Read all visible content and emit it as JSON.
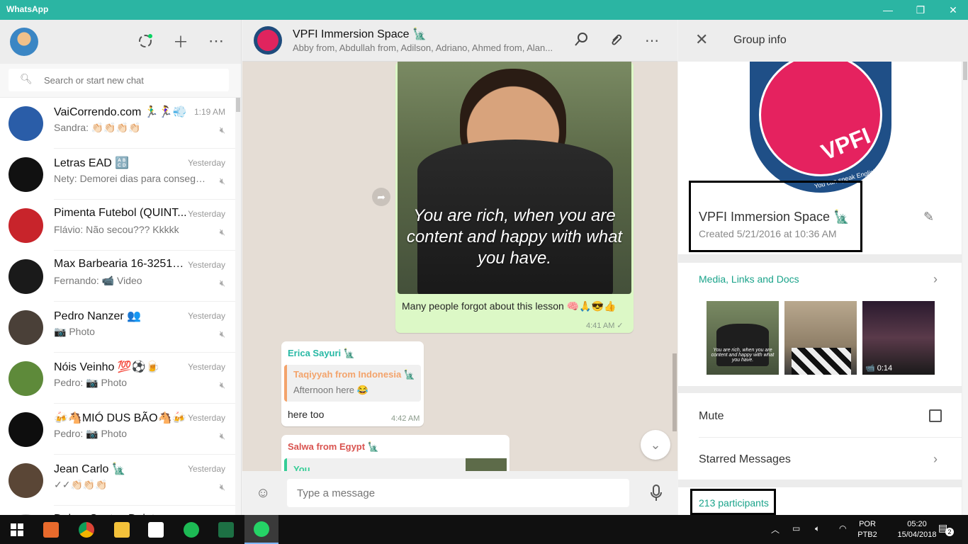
{
  "window": {
    "title": "WhatsApp"
  },
  "left": {
    "search_placeholder": "Search or start new chat",
    "chats": [
      {
        "name": "VaiCorrendo.com 🏃‍♂️🏃‍♀️💨",
        "time": "1:19 AM",
        "preview": "Sandra: 👏🏻👏🏻👏🏻👏🏻",
        "avatar_color": "#2a5da8"
      },
      {
        "name": "Letras EAD 🔠",
        "time": "Yesterday",
        "preview": "Nety: Demorei dias para conseguir...",
        "avatar_color": "#111111"
      },
      {
        "name": "Pimenta Futebol (QUINT...",
        "time": "Yesterday",
        "preview": "Flávio: Não secou??? Kkkkk",
        "avatar_color": "#c8242b"
      },
      {
        "name": "Max Barbearia 16-32510...",
        "time": "Yesterday",
        "preview": "Fernando: 📹 Video",
        "avatar_color": "#1a1a1a"
      },
      {
        "name": "Pedro Nanzer 👥",
        "time": "Yesterday",
        "preview": "📷 Photo",
        "avatar_color": "#4a4038"
      },
      {
        "name": "Nóis Veinho 💯⚽🍺",
        "time": "Yesterday",
        "preview": "Pedro: 📷 Photo",
        "avatar_color": "#5e8a3a"
      },
      {
        "name": "🍻🐴MIÓ DUS BÃO🐴🍻",
        "time": "Yesterday",
        "preview": "Pedro: 📷 Photo",
        "avatar_color": "#0e0e0e"
      },
      {
        "name": "Jean Carlo 🗽",
        "time": "Yesterday",
        "preview": "✓✓👏🏻👏🏻👏🏻",
        "avatar_color": "#5a4636"
      },
      {
        "name": "Dahye Santos Daiet...",
        "time": "",
        "preview": "",
        "avatar_color": "#cccccc"
      }
    ]
  },
  "chat": {
    "name": "VPFI Immersion Space 🗽",
    "members": "Abby from, Abdullah from, Adilson, Adriano, Ahmed from, Alan...",
    "photo_caption": "You are rich, when you are content and happy with what you have.",
    "msg1_text": "Many people forgot about this lesson 🧠🙏😎👍",
    "msg1_time": "4:41 AM",
    "msg2_sender": "Erica Sayuri 🗽",
    "msg2_quote_sender": "Taqiyyah from Indonesia 🗽",
    "msg2_quote_text": "Afternoon here 😂",
    "msg2_text": "here too",
    "msg2_time": "4:42 AM",
    "msg3_sender": "Salwa from Egypt 🗽",
    "msg3_quote_sender": "You",
    "compose_placeholder": "Type a message"
  },
  "info": {
    "title": "Group info",
    "logo_text": "VPFI",
    "logo_subtext": "You can speak English!",
    "group_name": "VPFI Immersion Space 🗽",
    "created": "Created 5/21/2016 at 10:36 AM",
    "media_label": "Media, Links and Docs",
    "media_thumb_caption": "You are rich, when you are content and happy with what you have.",
    "video_duration": "📹 0:14",
    "mute_label": "Mute",
    "starred_label": "Starred Messages",
    "participants": "213 participants"
  },
  "taskbar": {
    "lang_top": "POR",
    "lang_bottom": "PTB2",
    "time": "05:20",
    "date": "15/04/2018",
    "notifications": "2"
  },
  "colors": {
    "accent": "#2bb5a3",
    "teal_link": "#1aa38a",
    "outgoing_bubble": "#dcf8c6"
  }
}
